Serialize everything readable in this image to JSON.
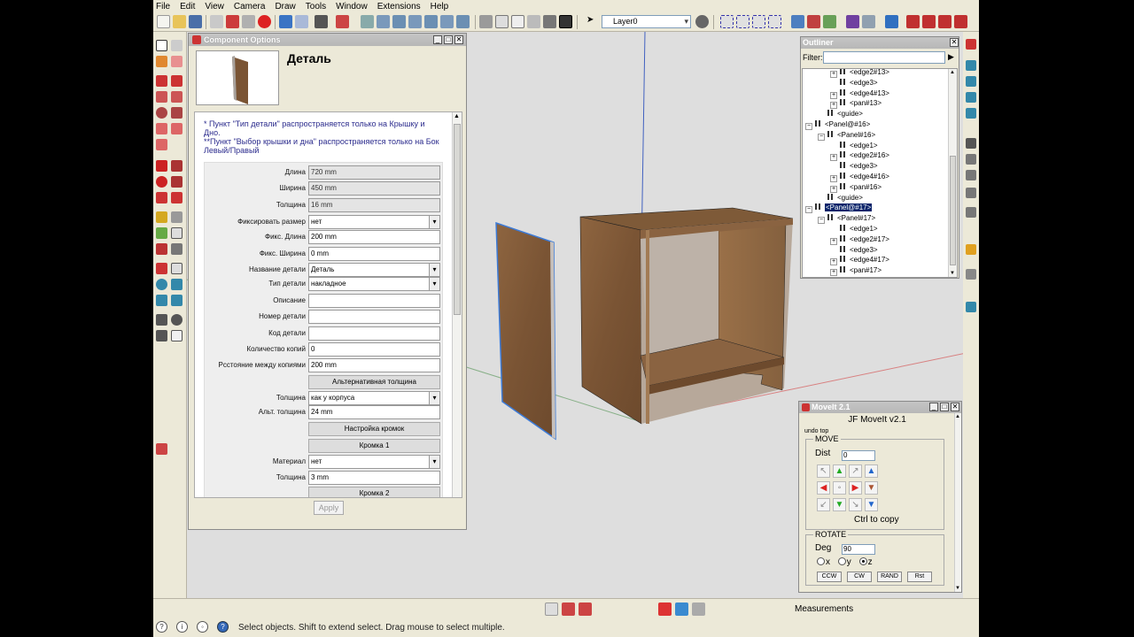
{
  "menu": [
    "File",
    "Edit",
    "View",
    "Camera",
    "Draw",
    "Tools",
    "Window",
    "Extensions",
    "Help"
  ],
  "toolbar": {
    "layer_value": "Layer0"
  },
  "component_options": {
    "title": "Component Options",
    "component_name": "Деталь",
    "note_line1": "* Пункт \"Тип детали\" распространяется только на Крышку и Дно.",
    "note_line2": "**Пункт \"Выбор крышки и дна\" распространяется только на Бок Левый/Правый",
    "fields": [
      {
        "label": "Длина",
        "value": "720 mm",
        "kind": "ro"
      },
      {
        "label": "Ширина",
        "value": "450 mm",
        "kind": "ro"
      },
      {
        "label": "Толщина",
        "value": "16 mm",
        "kind": "ro"
      },
      {
        "label": "Фиксировать размер",
        "value": "нет",
        "kind": "select"
      },
      {
        "label": "Фикс. Длина",
        "value": "200 mm",
        "kind": "text"
      },
      {
        "label": "Фикс. Ширина",
        "value": "0 mm",
        "kind": "text"
      },
      {
        "label": "Название детали",
        "value": "Деталь",
        "kind": "select"
      },
      {
        "label": "Тип детали",
        "value": "накладное",
        "kind": "select"
      },
      {
        "label": "Описание",
        "value": "",
        "kind": "text"
      },
      {
        "label": "Номер детали",
        "value": "",
        "kind": "text"
      },
      {
        "label": "Код детали",
        "value": "",
        "kind": "text"
      },
      {
        "label": "Количество копий",
        "value": "0",
        "kind": "text"
      },
      {
        "label": "Рсстояние между копиями",
        "value": "200 mm",
        "kind": "text"
      },
      {
        "label": "",
        "value": "Альтернативная толщина",
        "kind": "button"
      },
      {
        "label": "Толщина",
        "value": "как у корпуса",
        "kind": "select"
      },
      {
        "label": "Альт. толщина",
        "value": "24 mm",
        "kind": "text"
      },
      {
        "label": "",
        "value": "Настройка кромок",
        "kind": "button"
      },
      {
        "label": "",
        "value": "Кромка 1",
        "kind": "button"
      },
      {
        "label": "Материал",
        "value": "нет",
        "kind": "select"
      },
      {
        "label": "Толщина",
        "value": "3 mm",
        "kind": "text"
      },
      {
        "label": "",
        "value": "Кромка 2",
        "kind": "button"
      }
    ],
    "apply_label": "Apply"
  },
  "outliner": {
    "title": "Outliner",
    "filter_label": "Filter:",
    "rows": [
      {
        "text": "<edge2#13>",
        "indent": 2,
        "toggle": "+"
      },
      {
        "text": "<edge3>",
        "indent": 2,
        "toggle": ""
      },
      {
        "text": "<edge4#13>",
        "indent": 2,
        "toggle": "+"
      },
      {
        "text": "<pan#13>",
        "indent": 2,
        "toggle": "+"
      },
      {
        "text": "<guide>",
        "indent": 1,
        "toggle": ""
      },
      {
        "text": "<Panel@#16>",
        "indent": 0,
        "toggle": "−"
      },
      {
        "text": "<Panel#16>",
        "indent": 1,
        "toggle": "−"
      },
      {
        "text": "<edge1>",
        "indent": 2,
        "toggle": ""
      },
      {
        "text": "<edge2#16>",
        "indent": 2,
        "toggle": "+"
      },
      {
        "text": "<edge3>",
        "indent": 2,
        "toggle": ""
      },
      {
        "text": "<edge4#16>",
        "indent": 2,
        "toggle": "+"
      },
      {
        "text": "<pan#16>",
        "indent": 2,
        "toggle": "+"
      },
      {
        "text": "<guide>",
        "indent": 1,
        "toggle": ""
      },
      {
        "text": "<Panel@#17>",
        "indent": 0,
        "toggle": "−",
        "selected": true
      },
      {
        "text": "<Panel#17>",
        "indent": 1,
        "toggle": "−"
      },
      {
        "text": "<edge1>",
        "indent": 2,
        "toggle": ""
      },
      {
        "text": "<edge2#17>",
        "indent": 2,
        "toggle": "+"
      },
      {
        "text": "<edge3>",
        "indent": 2,
        "toggle": ""
      },
      {
        "text": "<edge4#17>",
        "indent": 2,
        "toggle": "+"
      },
      {
        "text": "<pan#17>",
        "indent": 2,
        "toggle": "+"
      }
    ]
  },
  "moveit": {
    "title": "MoveIt 2.1",
    "header": "JF MoveIt v2.1",
    "undo_label": "undo  top",
    "move_label": "MOVE",
    "dist_label": "Dist",
    "dist_value": "0",
    "ctrl_hint": "Ctrl to copy",
    "rotate_label": "ROTATE",
    "deg_label": "Deg",
    "deg_value": "90",
    "axis_x": "x",
    "axis_y": "y",
    "axis_z": "z",
    "buttons": [
      "CCW",
      "CW",
      "RAND",
      "Rst"
    ]
  },
  "status": {
    "hint": "Select objects. Shift to extend select. Drag mouse to select multiple.",
    "measurements_label": "Measurements"
  }
}
